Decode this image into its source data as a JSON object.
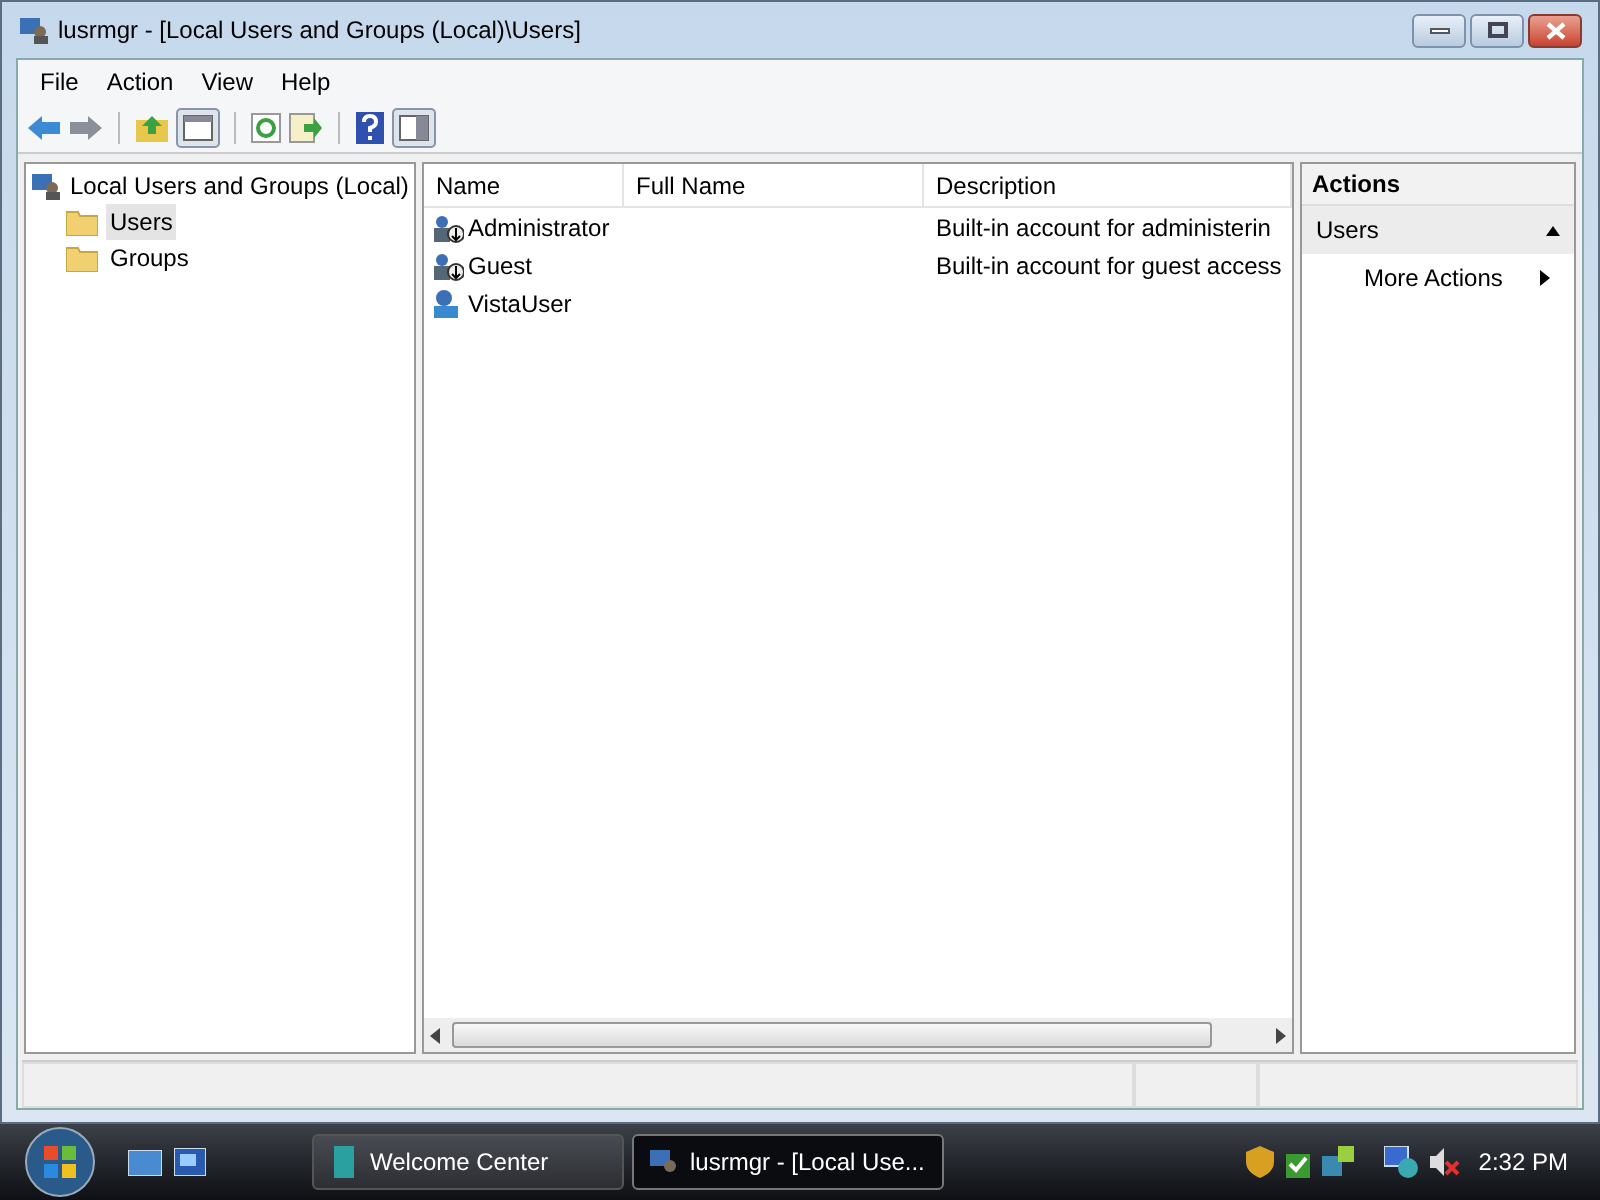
{
  "window": {
    "title": "lusrmgr - [Local Users and Groups (Local)\\Users]"
  },
  "menu": [
    "File",
    "Action",
    "View",
    "Help"
  ],
  "tree": {
    "label": "Local Users and Groups (Local)",
    "children": [
      {
        "label": "Users",
        "selected": true
      },
      {
        "label": "Groups",
        "selected": false
      }
    ]
  },
  "table": {
    "columns": [
      "Name",
      "Full Name",
      "Description"
    ],
    "rows": [
      {
        "name": "Administrator",
        "full_name": "",
        "description": "Built-in account for administerin",
        "kind": "disabled"
      },
      {
        "name": "Guest",
        "full_name": "",
        "description": "Built-in account for guest access",
        "kind": "disabled"
      },
      {
        "name": "VistaUser",
        "full_name": "",
        "description": "",
        "kind": "user"
      }
    ]
  },
  "actions": {
    "title": "Actions",
    "section": "Users",
    "items": [
      "More Actions"
    ]
  },
  "taskbar": {
    "buttons": [
      {
        "label": "Welcome Center",
        "selected": false
      },
      {
        "label": "lusrmgr - [Local Use...",
        "selected": true
      }
    ],
    "clock": "2:32 PM"
  }
}
